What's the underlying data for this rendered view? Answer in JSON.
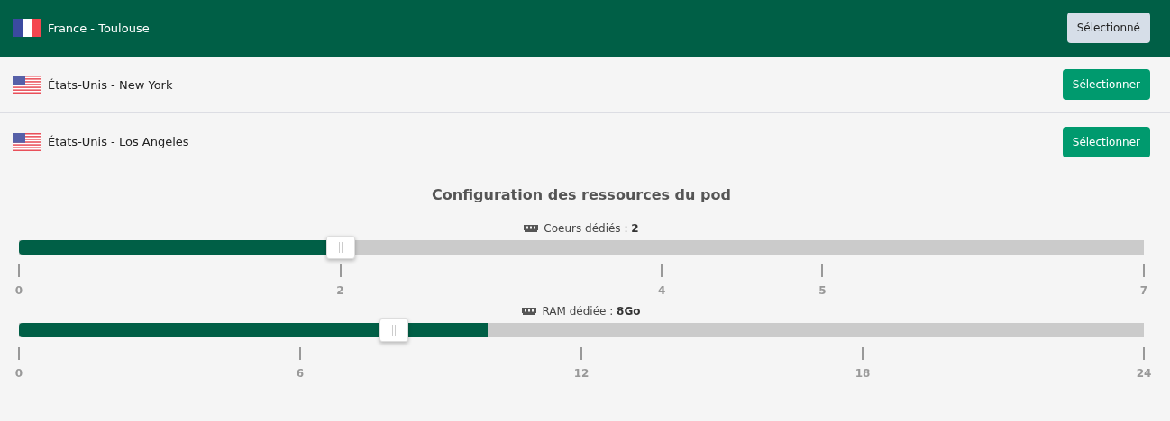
{
  "locations": [
    {
      "kind": "fr",
      "label": "France - Toulouse",
      "selected": true,
      "button": "Sélectionné"
    },
    {
      "kind": "us",
      "label": "États-Unis - New York",
      "selected": false,
      "button": "Sélectionner"
    },
    {
      "kind": "us",
      "label": "États-Unis - Los Angeles",
      "selected": false,
      "button": "Sélectionner"
    }
  ],
  "config": {
    "title": "Configuration des ressources du pod",
    "sliders": [
      {
        "label": "Coeurs dédiés : ",
        "value": "2",
        "level": 0.2857,
        "thumb": {
          "level": 0.2857
        },
        "ticks": [
          {
            "label": "0",
            "level": 0
          },
          {
            "label": "2",
            "level": 0.2857
          },
          {
            "label": "4",
            "level": 0.5714
          },
          {
            "label": "5",
            "level": 0.7143
          },
          {
            "label": "7",
            "level": 1
          }
        ]
      },
      {
        "label": "RAM dédiée : ",
        "value": "8Go",
        "level": 0.4167,
        "thumb": {
          "level": 0.3333
        },
        "ticks": [
          {
            "label": "0",
            "level": 0
          },
          {
            "label": "6",
            "level": 0.25
          },
          {
            "label": "12",
            "level": 0.5
          },
          {
            "label": "18",
            "level": 0.75
          },
          {
            "label": "24",
            "level": 1
          }
        ]
      }
    ]
  }
}
